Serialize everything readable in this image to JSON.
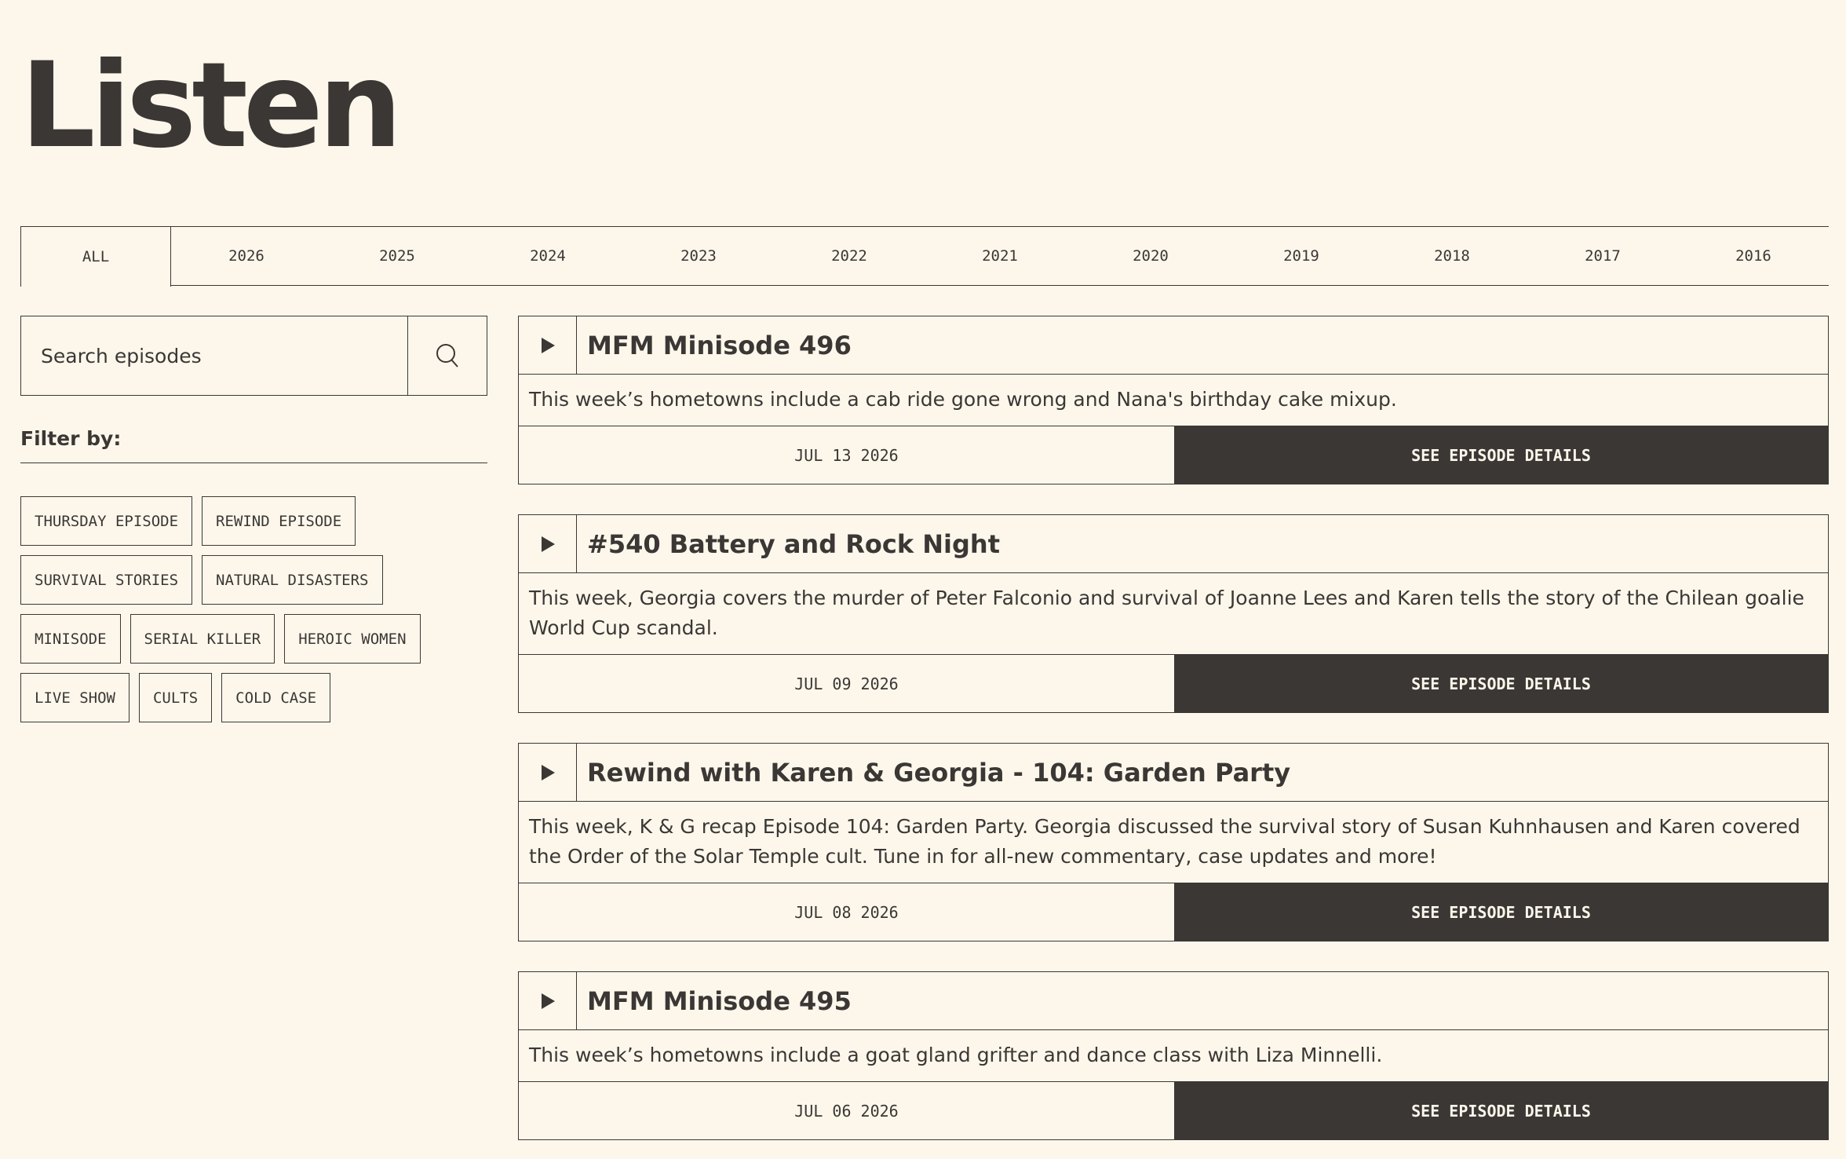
{
  "page": {
    "title": "Listen"
  },
  "tabs": [
    "ALL",
    "2026",
    "2025",
    "2024",
    "2023",
    "2022",
    "2021",
    "2020",
    "2019",
    "2018",
    "2017",
    "2016"
  ],
  "search": {
    "placeholder": "Search episodes"
  },
  "filter": {
    "label": "Filter by:",
    "tags": [
      "Thursday Episode",
      "Rewind Episode",
      "Survival Stories",
      "Natural Disasters",
      "Minisode",
      "Serial Killer",
      "Heroic Women",
      "Live Show",
      "Cults",
      "Cold Case"
    ]
  },
  "episodes": [
    {
      "title": "MFM Minisode 496",
      "description": "This week’s hometowns include a cab ride gone wrong and Nana's birthday cake mixup.",
      "date": "JUL 13 2026",
      "details_label": "See episode details"
    },
    {
      "title": "#540 Battery and Rock Night",
      "description": "This week, Georgia covers the murder of Peter Falconio and survival of Joanne Lees and Karen tells the story of the Chilean goalie World Cup scandal.",
      "date": "JUL 09 2026",
      "details_label": "See episode details"
    },
    {
      "title": "Rewind with Karen & Georgia - 104: Garden Party",
      "description": "This week, K & G recap Episode 104: Garden Party. Georgia discussed the survival story of Susan Kuhnhausen and Karen covered the Order of the Solar Temple cult. Tune in for all-new commentary, case updates and more!",
      "date": "JUL 08 2026",
      "details_label": "See episode details"
    },
    {
      "title": "MFM Minisode 495",
      "description": "This week’s hometowns include a goat gland grifter and dance class with Liza Minnelli.",
      "date": "JUL 06 2026",
      "details_label": "See episode details"
    }
  ],
  "icons": {
    "search": "search-icon",
    "play": "play-icon"
  },
  "colors": {
    "background": "#fdf7eb",
    "ink": "#3a3735"
  },
  "active_tab": "ALL"
}
